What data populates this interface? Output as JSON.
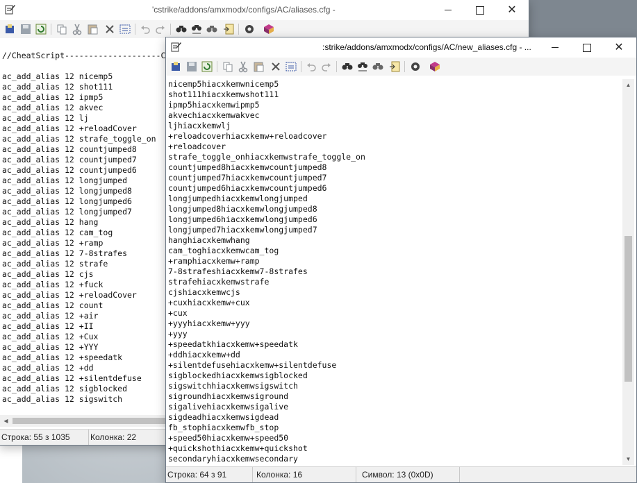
{
  "back_window": {
    "title": "'cstrike/addons/amxmodx/configs/AC/aliases.cfg -",
    "lines": [
      "",
      "//CheatScript--------------------C",
      "",
      "ac_add_alias 12 nicemp5",
      "ac_add_alias 12 shot111",
      "ac_add_alias 12 ipmp5",
      "ac_add_alias 12 akvec",
      "ac_add_alias 12 lj",
      "ac_add_alias 12 +reloadCover",
      "ac_add_alias 12 strafe_toggle_on",
      "ac_add_alias 12 countjumped8",
      "ac_add_alias 12 countjumped7",
      "ac_add_alias 12 countjumped6",
      "ac_add_alias 12 longjumped",
      "ac_add_alias 12 longjumped8",
      "ac_add_alias 12 longjumped6",
      "ac_add_alias 12 longjumped7",
      "ac_add_alias 12 hang",
      "ac_add_alias 12 cam_tog",
      "ac_add_alias 12 +ramp",
      "ac_add_alias 12 7-8strafes",
      "ac_add_alias 12 strafe",
      "ac_add_alias 12 cjs",
      "ac_add_alias 12 +fuck",
      "ac_add_alias 12 +reloadCover",
      "ac_add_alias 12 count",
      "ac_add_alias 12 +air",
      "ac_add_alias 12 +II",
      "ac_add_alias 12 +Cux",
      "ac_add_alias 12 +YYY",
      "ac_add_alias 12 +speedatk",
      "ac_add_alias 12 +dd",
      "ac_add_alias 12 +silentdefuse",
      "ac_add_alias 12 sigblocked",
      "ac_add_alias 12 sigswitch"
    ],
    "status": {
      "row": "Строка: 55 з 1035",
      "col": "Колонка: 22"
    }
  },
  "front_window": {
    "title": ":strike/addons/amxmodx/configs/AC/new_aliases.cfg - ...",
    "lines": [
      "nicemp5hiacxkemwnicemp5",
      "shot111hiacxkemwshot111",
      "ipmp5hiacxkemwipmp5",
      "akvechiacxkemwakvec",
      "ljhiacxkemwlj",
      "+reloadcoverhiacxkemw+reloadcover",
      "+reloadcover",
      "strafe_toggle_onhiacxkemwstrafe_toggle_on",
      "countjumped8hiacxkemwcountjumped8",
      "countjumped7hiacxkemwcountjumped7",
      "countjumped6hiacxkemwcountjumped6",
      "longjumpedhiacxkemwlongjumped",
      "longjumped8hiacxkemwlongjumped8",
      "longjumped6hiacxkemwlongjumped6",
      "longjumped7hiacxkemwlongjumped7",
      "hanghiacxkemwhang",
      "cam_toghiacxkemwcam_tog",
      "+ramphiacxkemw+ramp",
      "7-8strafeshiacxkemw7-8strafes",
      "strafehiacxkemwstrafe",
      "cjshiacxkemwcjs",
      "+cuxhiacxkemw+cux",
      "+cux",
      "+yyyhiacxkemw+yyy",
      "+yyy",
      "+speedatkhiacxkemw+speedatk",
      "+ddhiacxkemw+dd",
      "+silentdefusehiacxkemw+silentdefuse",
      "sigblockedhiacxkemwsigblocked",
      "sigswitchhiacxkemwsigswitch",
      "sigroundhiacxkemwsiground",
      "sigalivehiacxkemwsigalive",
      "sigdeadhiacxkemwsigdead",
      "fb_stophiacxkemwfb_stop",
      "+speed50hiacxkemw+speed50",
      "+quickshothiacxkemw+quickshot",
      "secondaryhiacxkemwsecondary"
    ],
    "status": {
      "row": "Строка: 64 з 91",
      "col": "Колонка: 16",
      "symbol": "Символ: 13 (0x0D)"
    }
  },
  "toolbar_icons": [
    "open-icon",
    "save-icon",
    "reload-icon",
    "copy-icon",
    "cut-icon",
    "paste-icon",
    "delete-icon",
    "select-all-icon",
    "undo-icon",
    "redo-icon",
    "find-icon",
    "find-replace-icon",
    "find-next-icon",
    "goto-icon",
    "settings-icon",
    "scheme-icon"
  ]
}
